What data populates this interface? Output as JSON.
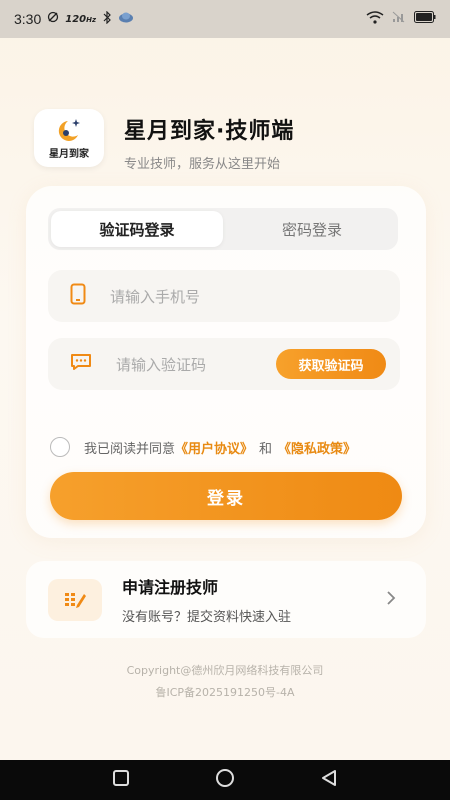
{
  "status_bar": {
    "time": "3:30",
    "network_rate": "120",
    "network_unit": "Hz"
  },
  "brand": {
    "logo_text": "星月到家",
    "title": "星月到家·技师端",
    "subtitle": "专业技师，服务从这里开始"
  },
  "login": {
    "tabs": [
      {
        "label": "验证码登录",
        "active": true
      },
      {
        "label": "密码登录",
        "active": false
      }
    ],
    "phone_placeholder": "请输入手机号",
    "code_placeholder": "请输入验证码",
    "get_code_label": "获取验证码",
    "agree_prefix": "我已阅读并同意",
    "user_agreement": "《用户协议》",
    "and_text": "和",
    "privacy_policy": "《隐私政策》",
    "login_button": "登录"
  },
  "register": {
    "title": "申请注册技师",
    "subtitle": "没有账号？提交资料快速入驻"
  },
  "footer": {
    "copyright": "Copyright@德州欣月网络科技有限公司",
    "icp": "鲁ICP备2025191250号-4A"
  },
  "colors": {
    "accent": "#F08A15",
    "accent_light": "#F7A12B"
  }
}
